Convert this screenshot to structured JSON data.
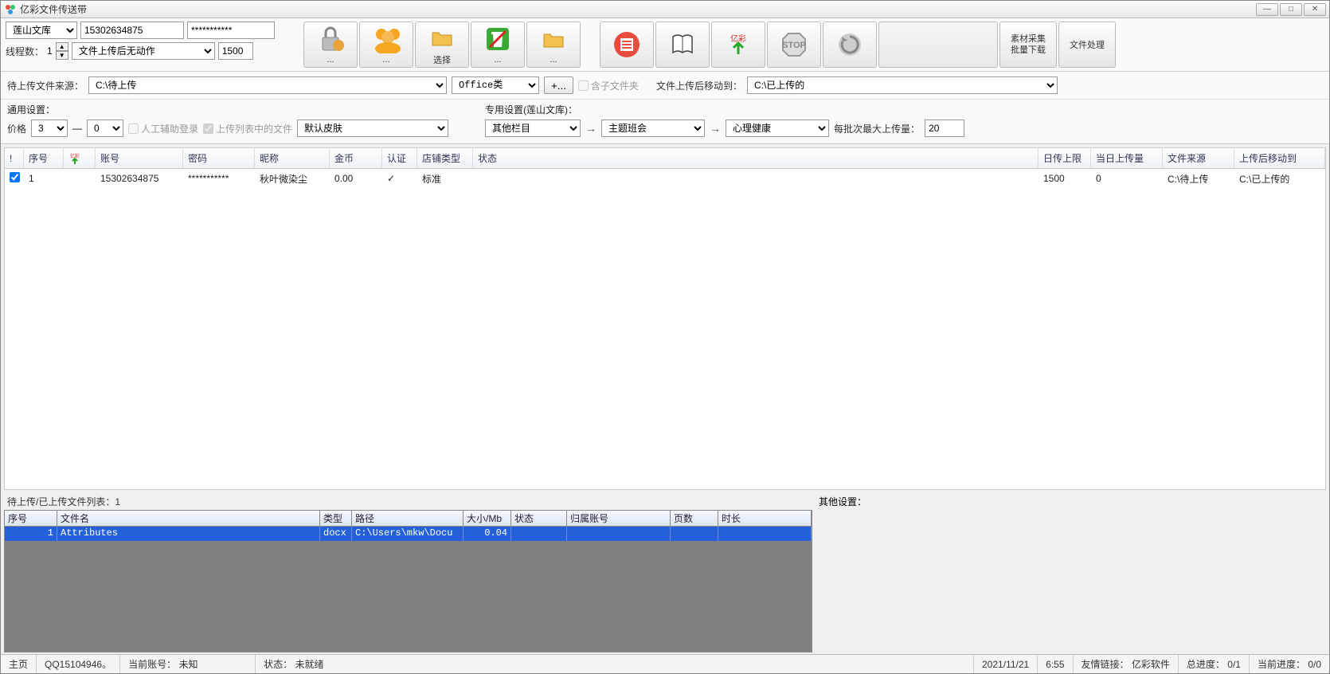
{
  "window": {
    "title": "亿彩文件传送带"
  },
  "top_left": {
    "lib_select": "莲山文库",
    "phone": "15302634875",
    "password_masked": "***********",
    "thread_label": "线程数：",
    "thread_value": "1",
    "action_select": "文件上传后无动作",
    "action_num": "1500"
  },
  "toolbar": {
    "btn_lock_label": "...",
    "btn_people_label": "...",
    "btn_select_label": "选择",
    "btn_trash_label": "...",
    "btn_folder2_label": "...",
    "btn_docred_label": "",
    "btn_book_label": "",
    "btn_upload_label": "",
    "btn_stop_label": "",
    "btn_refresh_label": "",
    "btn_rightpanel_label": "",
    "btn_material": "素材采集\n批量下载",
    "btn_fileproc": "文件处理"
  },
  "row2": {
    "src_label": "待上传文件来源：",
    "src_path": "C:\\待上传",
    "filter_select": "Office类",
    "plus_btn": "+...",
    "include_sub_label": "含子文件夹",
    "move_to_label": "文件上传后移动到：",
    "move_to_path": "C:\\已上传的"
  },
  "row3": {
    "general_label": "通用设置：",
    "price_label": "价格",
    "price_from": "3",
    "dash": "—",
    "price_to": "0",
    "manual_login": "人工辅助登录",
    "upload_list": "上传列表中的文件",
    "skin_select": "默认皮肤",
    "special_label": "专用设置(莲山文库)：",
    "cat1": "其他栏目",
    "cat2": "主题班会",
    "cat3": "心理健康",
    "batch_label": "每批次最大上传量：",
    "batch_value": "20"
  },
  "accounts_table": {
    "headers": [
      "!",
      "序号",
      "",
      "账号",
      "密码",
      "昵称",
      "金币",
      "认证",
      "店铺类型",
      "状态",
      "日传上限",
      "当日上传量",
      "文件来源",
      "上传后移动到"
    ],
    "row": {
      "idx": "1",
      "account": "15302634875",
      "pwd": "***********",
      "nick": "秋叶微染尘",
      "coin": "0.00",
      "auth": "✓",
      "shop": "标准",
      "status": "",
      "day_limit": "1500",
      "day_uploaded": "0",
      "src": "C:\\待上传",
      "dst": "C:\\已上传的"
    }
  },
  "pending": {
    "label": "待上传/已上传文件列表：1",
    "headers": [
      "序号",
      "文件名",
      "类型",
      "路径",
      "大小/Mb",
      "状态",
      "归属账号",
      "页数",
      "时长"
    ],
    "row": {
      "idx": "1",
      "name": "Attributes",
      "type": "docx",
      "path": "C:\\Users\\mkw\\Docu",
      "size": "0.04",
      "status": "",
      "owner": "",
      "pages": "",
      "duration": ""
    }
  },
  "other_settings_label": "其他设置：",
  "status": {
    "home": "主页",
    "qq": "QQ15104946。",
    "cur_acct_label": "当前账号：",
    "cur_acct_val": "未知",
    "state_label": "状态：",
    "state_val": "未就绪",
    "date": "2021/11/21",
    "time": "6:55",
    "friend_label": "友情链接：",
    "friend_val": "亿彩软件",
    "total_prog_label": "总进度：",
    "total_prog_val": "0/1",
    "cur_prog_label": "当前进度：",
    "cur_prog_val": "0/0"
  }
}
